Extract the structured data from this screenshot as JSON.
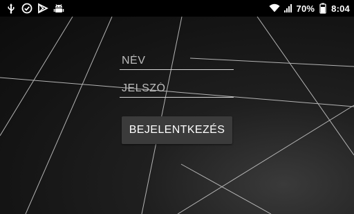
{
  "status_bar": {
    "left_icons": [
      "usb-icon",
      "check-circle-icon",
      "play-store-icon",
      "android-debug-icon"
    ],
    "right_icons": [
      "wifi-icon",
      "cell-signal-icon",
      "battery-icon"
    ],
    "battery_percent": "70%",
    "time": "8:04"
  },
  "form": {
    "name_placeholder": "NÉV",
    "password_placeholder": "JELSZÓ",
    "login_label": "BEJELENTKEZÉS"
  },
  "colors": {
    "background": "#141414",
    "line": "#cfcfcf",
    "button": "#3b3b3b",
    "text": "#ffffff"
  }
}
